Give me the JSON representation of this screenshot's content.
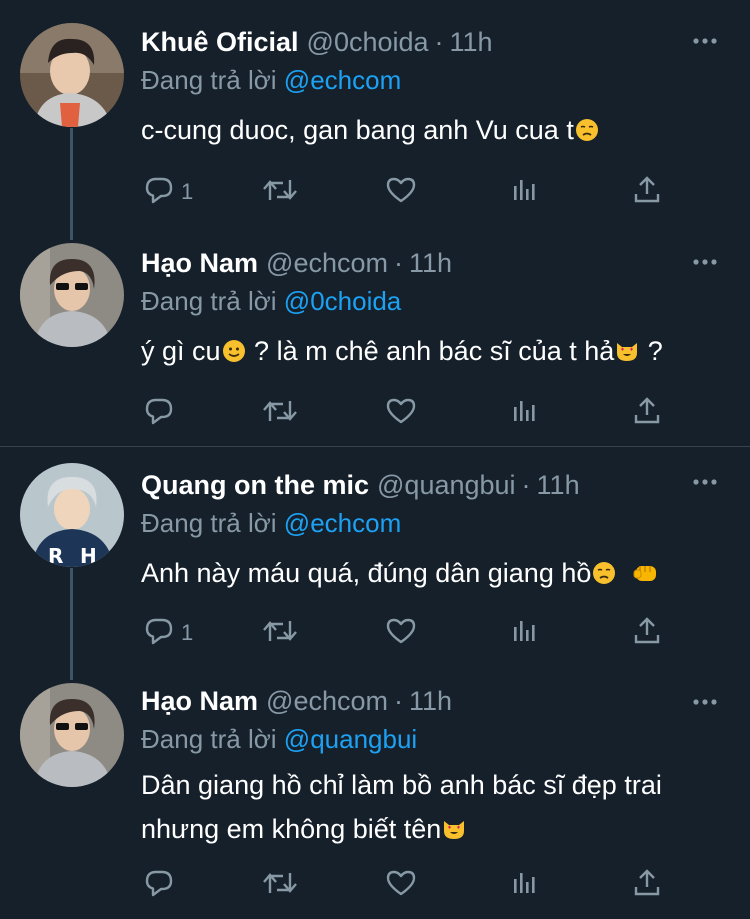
{
  "tweets": [
    {
      "display_name": "Khuê Oficial",
      "handle": "@0choida",
      "time": "11h",
      "reply_prefix": "Đang trả lời",
      "reply_to": "@echcom",
      "text": "c-cung duoc, gan bang anh Vu cua t",
      "reply_count": "1"
    },
    {
      "display_name": "Hạo Nam",
      "handle": "@echcom",
      "time": "11h",
      "reply_prefix": "Đang trả lời",
      "reply_to": "@0choida",
      "text_parts": [
        "ý gì cu",
        " ? là m chê anh bác sĩ của t hả",
        " ?"
      ],
      "reply_count": ""
    },
    {
      "display_name": "Quang on the mic",
      "handle": "@quangbui",
      "time": "11h",
      "reply_prefix": "Đang trả lời",
      "reply_to": "@echcom",
      "text": "Anh này máu quá, đúng dân giang hồ",
      "reply_count": "1"
    },
    {
      "display_name": "Hạo Nam",
      "handle": "@echcom",
      "time": "11h",
      "reply_prefix": "Đang trả lời",
      "reply_to": "@quangbui",
      "text_line1": "Dân giang hồ chỉ làm bồ anh bác sĩ đẹp trai",
      "text_line2": "nhưng em không biết tên",
      "reply_count": ""
    }
  ],
  "separator": "·",
  "icons": [
    "reply-icon",
    "retweet-icon",
    "like-icon",
    "analytics-icon",
    "share-icon",
    "more-icon"
  ],
  "colors": {
    "background": "#15202b",
    "secondary_text": "#8899a6",
    "link": "#1da1f2",
    "divider": "#38444d",
    "thread_line": "#3d5466"
  }
}
